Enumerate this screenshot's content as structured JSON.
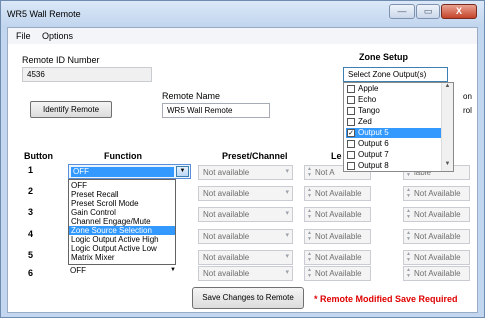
{
  "window": {
    "title": "WR5 Wall Remote",
    "minimize_glyph": "—",
    "maximize_glyph": "▭",
    "close_glyph": "X"
  },
  "menu": {
    "items": [
      "File",
      "Options"
    ]
  },
  "remote": {
    "id_label": "Remote ID Number",
    "id_value": "4536",
    "identify_button": "Identify Remote",
    "name_label": "Remote Name",
    "name_value": "WR5 Wall Remote"
  },
  "zone_setup": {
    "title": "Zone Setup",
    "select_label": "Select Zone Output(s)",
    "options": [
      {
        "label": "Apple",
        "checked": false
      },
      {
        "label": "Echo",
        "checked": false
      },
      {
        "label": "Tango",
        "checked": false
      },
      {
        "label": "Zed",
        "checked": false
      },
      {
        "label": "Output 5",
        "checked": true
      },
      {
        "label": "Output 6",
        "checked": false
      },
      {
        "label": "Output 7",
        "checked": false
      },
      {
        "label": "Output 8",
        "checked": false
      }
    ],
    "partial_right_1": "on",
    "partial_right_2": "rol"
  },
  "table": {
    "headers": {
      "button": "Button",
      "function": "Function",
      "preset": "Preset/Channel",
      "level": "Le"
    },
    "rows": [
      {
        "button": "1",
        "function": "OFF",
        "preset": "Not available",
        "level_a": "Not A",
        "level_b": "lable"
      },
      {
        "button": "2",
        "function": "",
        "preset": "Not available",
        "level_a": "Not Available",
        "level_b": "Not Available"
      },
      {
        "button": "3",
        "function": "",
        "preset": "Not available",
        "level_a": "Not Available",
        "level_b": "Not Available"
      },
      {
        "button": "4",
        "function": "",
        "preset": "Not available",
        "level_a": "Not Available",
        "level_b": "Not Available"
      },
      {
        "button": "5",
        "function": "",
        "preset": "Not available",
        "level_a": "Not Available",
        "level_b": "Not Available"
      },
      {
        "button": "6",
        "function": "OFF",
        "preset": "Not available",
        "level_a": "Not Available",
        "level_b": "Not Available"
      }
    ]
  },
  "function_dropdown": {
    "options": [
      "OFF",
      "Preset Recall",
      "Preset Scroll Mode",
      "Gain Control",
      "Channel Engage/Mute",
      "Zone Source Selection",
      "Logic Output Active High",
      "Logic Output Active Low",
      "Matrix Mixer"
    ],
    "highlighted_index": 5
  },
  "footer": {
    "save_button": "Save Changes to Remote",
    "status": "* Remote Modified Save Required"
  },
  "colors": {
    "highlight": "#3399ff",
    "warning": "#e00000",
    "window_frame": "#c2d7ef"
  }
}
